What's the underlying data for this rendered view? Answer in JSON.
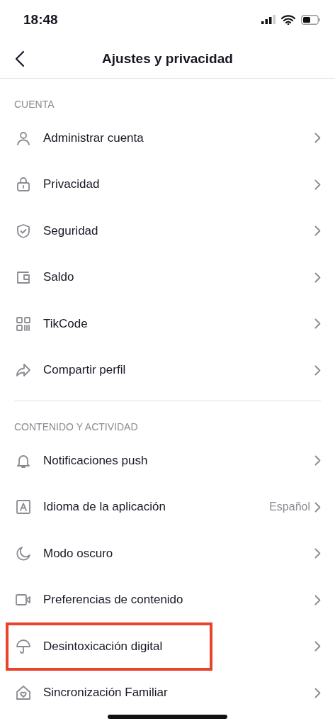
{
  "status_bar": {
    "time": "18:48"
  },
  "header": {
    "title": "Ajustes y privacidad"
  },
  "sections": [
    {
      "title": "CUENTA",
      "items": [
        {
          "label": "Administrar cuenta",
          "highlighted": false
        },
        {
          "label": "Privacidad",
          "highlighted": false
        },
        {
          "label": "Seguridad",
          "highlighted": false
        },
        {
          "label": "Saldo",
          "highlighted": false
        },
        {
          "label": "TikCode",
          "highlighted": false
        },
        {
          "label": "Compartir perfil",
          "highlighted": false
        }
      ]
    },
    {
      "title": "CONTENIDO Y ACTIVIDAD",
      "items": [
        {
          "label": "Notificaciones push",
          "highlighted": false
        },
        {
          "label": "Idioma de la aplicación",
          "value": "Español",
          "highlighted": false
        },
        {
          "label": "Modo oscuro",
          "highlighted": false
        },
        {
          "label": "Preferencias de contenido",
          "highlighted": false
        },
        {
          "label": "Desintoxicación digital",
          "highlighted": true
        },
        {
          "label": "Sincronización Familiar",
          "highlighted": false
        }
      ]
    }
  ]
}
